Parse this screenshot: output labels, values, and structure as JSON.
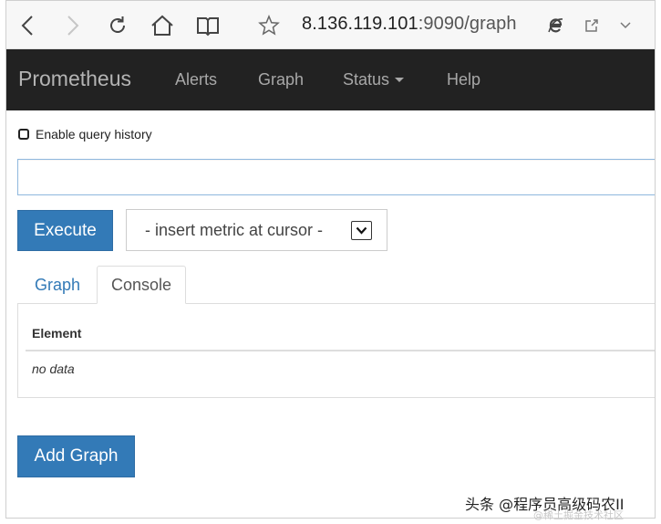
{
  "browser": {
    "url_host": "8.136.119.101",
    "url_rest": ":9090/graph",
    "icons": [
      "back-icon",
      "forward-icon",
      "reload-icon",
      "home-icon",
      "reading-view-icon",
      "favorite-star-icon",
      "ie-icon",
      "share-icon",
      "chevron-down-icon"
    ]
  },
  "navbar": {
    "brand": "Prometheus",
    "items": [
      {
        "label": "Alerts"
      },
      {
        "label": "Graph"
      },
      {
        "label": "Status"
      },
      {
        "label": "Help"
      }
    ]
  },
  "query": {
    "history_label": "Enable query history",
    "history_checked": false,
    "input_value": "",
    "execute_label": "Execute",
    "metric_select_value": "- insert metric at cursor -"
  },
  "tabs": [
    {
      "label": "Graph",
      "active": false
    },
    {
      "label": "Console",
      "active": true
    }
  ],
  "console": {
    "column_header": "Element",
    "empty_text": "no data"
  },
  "add_graph_label": "Add Graph",
  "watermark": {
    "line1": "头条 @程序员高级码农II",
    "line2": "@稀土掘金技术社区"
  },
  "colors": {
    "navbar_bg": "#222222",
    "primary": "#337ab7",
    "link": "#337ab7"
  }
}
